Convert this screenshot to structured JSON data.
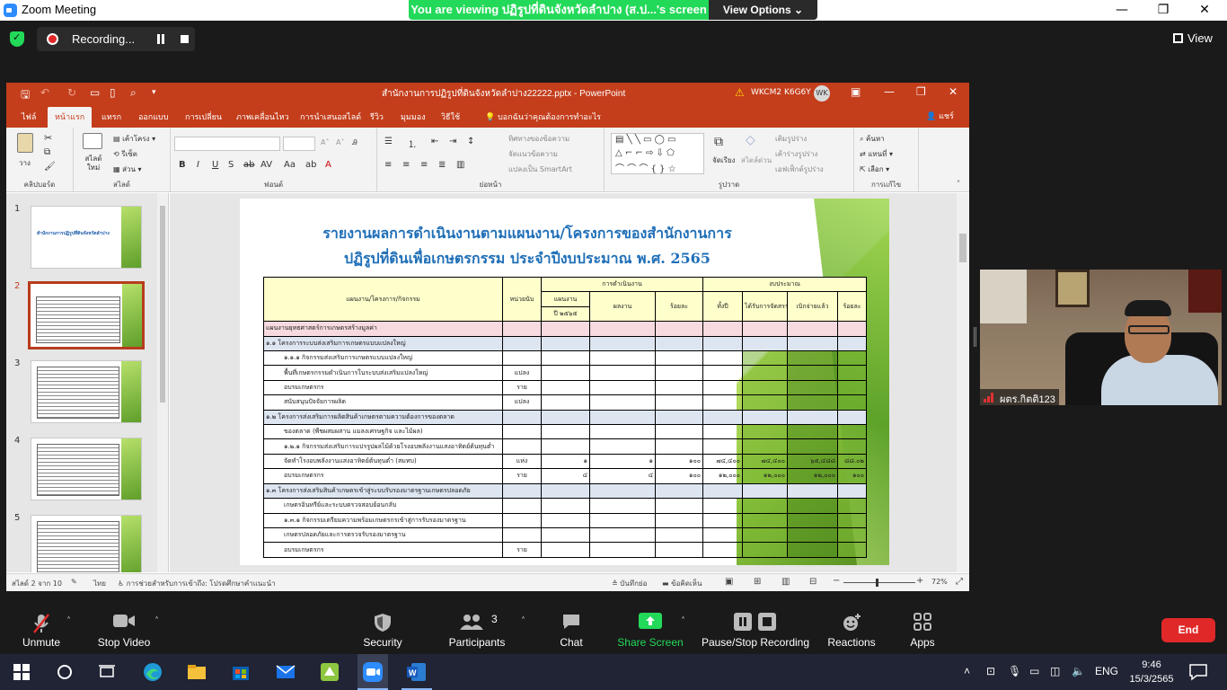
{
  "zoom": {
    "title": "Zoom Meeting",
    "banner": "You are viewing ปฏิรูปที่ดินจังหวัดลำปาง (ส.ป...'s screen",
    "view_options": "View Options",
    "recording": "Recording...",
    "view": "View",
    "participant_name": "ผตร.กิตติ123",
    "participants_count": "3",
    "end": "End",
    "toolbar": [
      {
        "label": "Unmute",
        "icon": "mic-muted-icon"
      },
      {
        "label": "Stop Video",
        "icon": "video-camera-icon"
      },
      {
        "label": "Security",
        "icon": "shield-icon"
      },
      {
        "label": "Participants",
        "icon": "participants-icon"
      },
      {
        "label": "Chat",
        "icon": "chat-icon"
      },
      {
        "label": "Share Screen",
        "icon": "share-screen-icon"
      },
      {
        "label": "Pause/Stop Recording",
        "icon": "pause-stop-icon"
      },
      {
        "label": "Reactions",
        "icon": "reactions-icon"
      },
      {
        "label": "Apps",
        "icon": "apps-icon"
      }
    ],
    "colors": {
      "accent_green": "#23d959",
      "end_red": "#e02828",
      "recording_red": "#e02828"
    }
  },
  "ppt": {
    "doc_title": "สำนักงานการปฏิรูปที่ดินจังหวัดลำปาง22222.pptx  -  PowerPoint",
    "user_id": "WKCM2 K6G6Y",
    "user_initials": "WK",
    "tabs": [
      "ไฟล์",
      "หน้าแรก",
      "แทรก",
      "ออกแบบ",
      "การเปลี่ยน",
      "ภาพเคลื่อนไหว",
      "การนำเสนอสไลด์",
      "รีวิว",
      "มุมมอง",
      "วิธีใช้"
    ],
    "active_tab": "หน้าแรก",
    "tell_me": "บอกฉันว่าคุณต้องการทำอะไร",
    "share": "แชร์",
    "ribbon_groups": [
      "คลิปบอร์ด",
      "สไลด์",
      "ฟอนต์",
      "ย่อหน้า",
      "รูปวาด",
      "การแก้ไข"
    ],
    "ribbon": {
      "paste": "วาง",
      "new_slide": "สไลด์ใหม่",
      "layout": "เค้าโครง",
      "reset": "รีเซ็ต",
      "section": "ส่วน",
      "text_direction": "ทิศทางของข้อความ",
      "align_text": "จัดแนวข้อความ",
      "smartart": "แปลงเป็น SmartArt",
      "arrange": "จัดเรียง",
      "quick_styles": "สไตล์ด่วน",
      "shape_fill": "เติมรูปร่าง",
      "shape_outline": "เค้าร่างรูปร่าง",
      "shape_effects": "เอฟเฟ็กต์รูปร่าง",
      "find": "ค้นหา",
      "replace": "แทนที่",
      "select": "เลือก"
    },
    "thumbs": [
      {
        "num": "1",
        "title": "สำนักงานการปฏิรูปที่ดินจังหวัดลำปาง"
      },
      {
        "num": "2",
        "title": ""
      },
      {
        "num": "3",
        "title": ""
      },
      {
        "num": "4",
        "title": ""
      },
      {
        "num": "5",
        "title": ""
      }
    ],
    "status": {
      "slide_info": "สไลด์ 2 จาก 10",
      "language": "ไทย",
      "accessibility": "การช่วยสำหรับการเข้าถึง: โปรดศึกษาคำแนะนำ",
      "notes": "บันทึกย่อ",
      "comments": "ข้อคิดเห็น",
      "zoom_minus": "−",
      "zoom_plus": "+",
      "zoom": "72%"
    }
  },
  "slide": {
    "title_line1": "รายงานผลการดำเนินงานตามแผนงาน/โครงการของสำนักงานการ",
    "title_line2": "ปฏิรูปที่ดินเพื่อเกษตรกรรม ประจำปีงบประมาณ พ.ศ. 2565",
    "headers": {
      "plan": "แผนงาน/โครงการ/กิจกรรม",
      "unit": "หน่วยนับ",
      "performance": "การดำเนินงาน",
      "budget": "งบประมาณ",
      "target": "แผนงาน",
      "target_year": "ปี ๒๕๖๕",
      "result": "ผลงาน",
      "percent": "ร้อยละ",
      "all": "ทั้งปี",
      "allocated": "ได้รับการจัดสรร",
      "disbursed": "เบิกจ่ายแล้ว",
      "percent2": "ร้อยละ"
    },
    "rows": [
      {
        "style": "pink",
        "label": "แผนงานยุทธศาสตร์การเกษตรสร้างมูลค่า",
        "unit": "",
        "target": "",
        "result": "",
        "pct": "",
        "all": "",
        "alloc": "",
        "disb": "",
        "pct2": ""
      },
      {
        "style": "blue",
        "label": "๑.๑ โครงการระบบส่งเสริมการเกษตรแบบแปลงใหญ่",
        "unit": "",
        "target": "",
        "result": "",
        "pct": "",
        "all": "",
        "alloc": "",
        "disb": "",
        "pct2": ""
      },
      {
        "style": "",
        "label": "๑.๑.๑ กิจกรรมส่งเสริมการเกษตรแบบแปลงใหญ่",
        "unit": "",
        "target": "",
        "result": "",
        "pct": "",
        "all": "",
        "alloc": "",
        "disb": "",
        "pct2": ""
      },
      {
        "style": "",
        "label": "พื้นที่เกษตรกรรมดำเนินการในระบบส่งเสริมแปลงใหญ่",
        "unit": "แปลง",
        "target": "",
        "result": "",
        "pct": "",
        "all": "",
        "alloc": "",
        "disb": "",
        "pct2": ""
      },
      {
        "style": "",
        "label": "อบรมเกษตรกร",
        "unit": "ราย",
        "target": "",
        "result": "",
        "pct": "",
        "all": "",
        "alloc": "",
        "disb": "",
        "pct2": ""
      },
      {
        "style": "",
        "label": "สนับสนุนปัจจัยการผลิต",
        "unit": "แปลง",
        "target": "",
        "result": "",
        "pct": "",
        "all": "",
        "alloc": "",
        "disb": "",
        "pct2": ""
      },
      {
        "style": "blue",
        "label": "๑.๒ โครงการส่งเสริมการผลิตสินค้าเกษตรตามความต้องการของตลาด",
        "unit": "",
        "target": "",
        "result": "",
        "pct": "",
        "all": "",
        "alloc": "",
        "disb": "",
        "pct2": ""
      },
      {
        "style": "",
        "label": "ของตลาด (พืชผสมผสาน แมลงเศรษฐกิจ และไม้ผล)",
        "unit": "",
        "target": "",
        "result": "",
        "pct": "",
        "all": "",
        "alloc": "",
        "disb": "",
        "pct2": ""
      },
      {
        "style": "",
        "label": "๑.๒.๑ กิจกรรมส่งเสริมการแปรรูปผลไม้ด้วยโรงอบพลังงานแสงอาทิตย์ต้นทุนต่ำ",
        "unit": "",
        "target": "",
        "result": "",
        "pct": "",
        "all": "",
        "alloc": "",
        "disb": "",
        "pct2": ""
      },
      {
        "style": "",
        "label": "จัดทำโรงอบพลังงานแสงอาทิตย์ต้นทุนต่ำ (สมทบ)",
        "unit": "แห่ง",
        "target": "๑",
        "result": "๑",
        "pct": "๑๐๐",
        "all": "๗๔,๔๐๐",
        "alloc": "๗๔,๔๐๐",
        "disb": "๖๕,๔๘๘",
        "pct2": "๘๘.๐๒"
      },
      {
        "style": "",
        "label": "อบรมเกษตรกร",
        "unit": "ราย",
        "target": "๔",
        "result": "๔",
        "pct": "๑๐๐",
        "all": "๑๒,๐๐๐",
        "alloc": "๑๒,๐๐๐",
        "disb": "๑๒,๐๐๐",
        "pct2": "๑๐๐"
      },
      {
        "style": "blue",
        "label": "๑.๓ โครงการส่งเสริมสินค้าเกษตรเข้าสู่ระบบรับรองมาตรฐานเกษตรปลอดภัย",
        "unit": "",
        "target": "",
        "result": "",
        "pct": "",
        "all": "",
        "alloc": "",
        "disb": "",
        "pct2": ""
      },
      {
        "style": "",
        "label": "เกษตรอินทรีย์และระบบตรวจสอบย้อนกลับ",
        "unit": "",
        "target": "",
        "result": "",
        "pct": "",
        "all": "",
        "alloc": "",
        "disb": "",
        "pct2": ""
      },
      {
        "style": "",
        "label": "๑.๓.๑ กิจกรรมเตรียมความพร้อมเกษตรกรเข้าสู่การรับรองมาตรฐาน",
        "unit": "",
        "target": "",
        "result": "",
        "pct": "",
        "all": "",
        "alloc": "",
        "disb": "",
        "pct2": ""
      },
      {
        "style": "",
        "label": "เกษตรปลอดภัยและการตรวจรับรองมาตรฐาน",
        "unit": "",
        "target": "",
        "result": "",
        "pct": "",
        "all": "",
        "alloc": "",
        "disb": "",
        "pct2": ""
      },
      {
        "style": "",
        "label": "อบรมเกษตรกร",
        "unit": "ราย",
        "target": "",
        "result": "",
        "pct": "",
        "all": "",
        "alloc": "",
        "disb": "",
        "pct2": ""
      }
    ]
  },
  "taskbar": {
    "language": "ENG",
    "time": "9:46",
    "date": "15/3/2565"
  }
}
